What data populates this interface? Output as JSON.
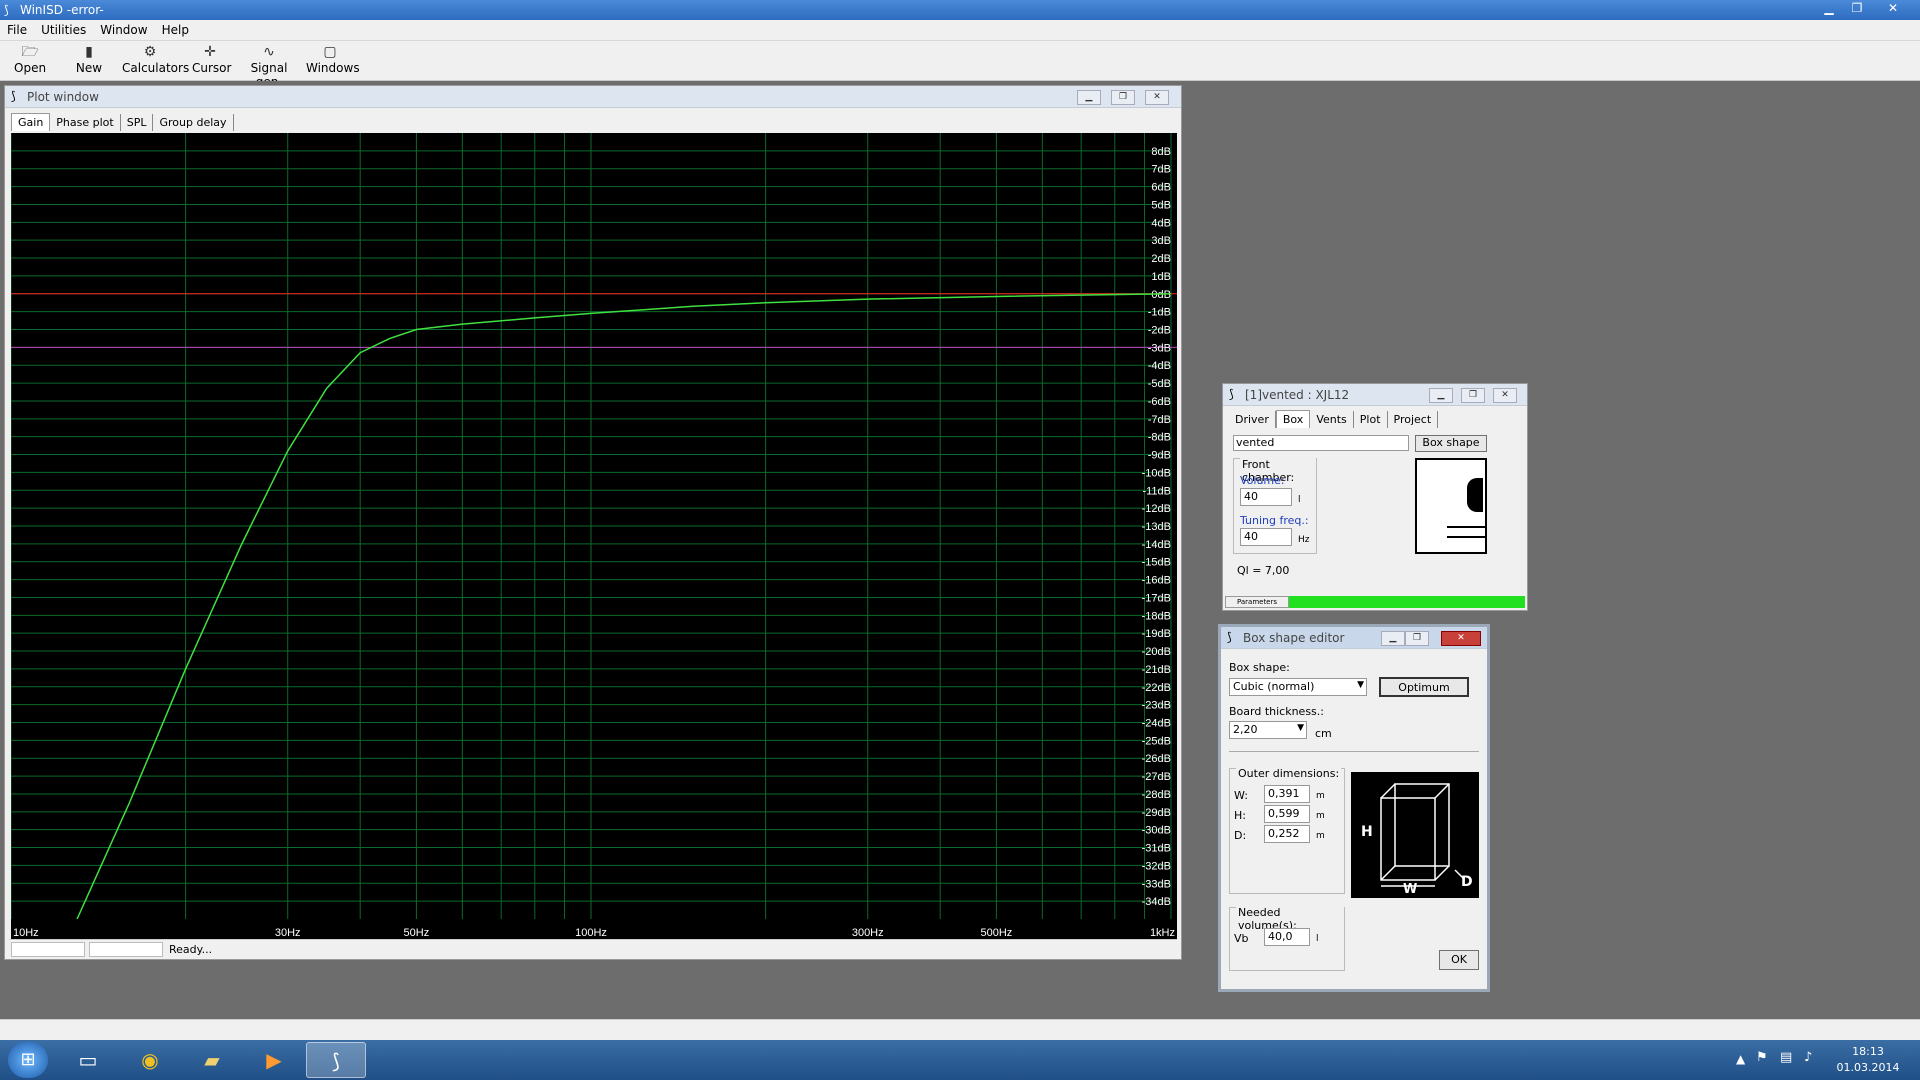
{
  "app": {
    "title": "WinISD -error-"
  },
  "menu": [
    "File",
    "Utilities",
    "Window",
    "Help"
  ],
  "toolbar": [
    {
      "label": "Open",
      "icon": "open-folder-icon",
      "glyph": "🗁"
    },
    {
      "label": "New",
      "icon": "new-file-icon",
      "glyph": "▮"
    },
    {
      "label": "Calculators",
      "icon": "calculators-icon",
      "glyph": "⚙"
    },
    {
      "label": "Cursor",
      "icon": "cursor-icon",
      "glyph": "✛"
    },
    {
      "label": "Signal gen.",
      "icon": "signal-gen-icon",
      "glyph": "∿"
    },
    {
      "label": "Windows",
      "icon": "windows-icon",
      "glyph": "▢"
    }
  ],
  "plot_window": {
    "title": "Plot window",
    "tabs": [
      "Gain",
      "Phase plot",
      "SPL",
      "Group delay"
    ],
    "active_tab": "Gain",
    "status": "Ready..."
  },
  "chart_data": {
    "type": "line",
    "title": "",
    "xlabel": "",
    "ylabel": "",
    "x_scale": "log",
    "xlim": [
      10,
      1000
    ],
    "ylim": [
      -35,
      9
    ],
    "grid": true,
    "x_tick_labels": [
      "10Hz",
      "30Hz",
      "50Hz",
      "100Hz",
      "300Hz",
      "500Hz",
      "1kHz"
    ],
    "x_tick_values": [
      10,
      30,
      50,
      100,
      300,
      500,
      1000
    ],
    "y_tick_values": [
      8,
      7,
      6,
      5,
      4,
      3,
      2,
      1,
      0,
      -1,
      -2,
      -3,
      -4,
      -5,
      -6,
      -7,
      -8,
      -9,
      -10,
      -11,
      -12,
      -13,
      -14,
      -15,
      -16,
      -17,
      -18,
      -19,
      -20,
      -21,
      -22,
      -23,
      -24,
      -25,
      -26,
      -27,
      -28,
      -29,
      -30,
      -31,
      -32,
      -33,
      -34
    ],
    "y_tick_labels": [
      "8dB",
      "7dB",
      "6dB",
      "5dB",
      "4dB",
      "3dB",
      "2dB",
      "1dB",
      "0dB",
      "-1dB",
      "-2dB",
      "-3dB",
      "-4dB",
      "-5dB",
      "-6dB",
      "-7dB",
      "-8dB",
      "-9dB",
      "-10dB",
      "-11dB",
      "-12dB",
      "-13dB",
      "-14dB",
      "-15dB",
      "-16dB",
      "-17dB",
      "-18dB",
      "-19dB",
      "-20dB",
      "-21dB",
      "-22dB",
      "-23dB",
      "-24dB",
      "-25dB",
      "-26dB",
      "-27dB",
      "-28dB",
      "-29dB",
      "-30dB",
      "-31dB",
      "-32dB",
      "-33dB",
      "-34dB"
    ],
    "reference_lines": [
      {
        "y": 0,
        "color": "#ff2020"
      },
      {
        "y": -3,
        "color": "#c040c0"
      }
    ],
    "series": [
      {
        "color": "#40e040",
        "x": [
          13,
          16,
          20,
          25,
          30,
          35,
          40,
          45,
          50,
          60,
          80,
          100,
          150,
          200,
          300,
          500,
          1000
        ],
        "y": [
          -36,
          -28.5,
          -21,
          -14,
          -8.8,
          -5.3,
          -3.3,
          -2.5,
          -2.0,
          -1.7,
          -1.35,
          -1.1,
          -0.7,
          -0.5,
          -0.3,
          -0.15,
          0.0
        ]
      }
    ],
    "colors": {
      "background": "#000000",
      "grid": "#0b6b2a",
      "axis_text": "#ffffff"
    }
  },
  "box_window": {
    "title": "[1]vented : XJL12",
    "tabs": [
      "Driver",
      "Box",
      "Vents",
      "Plot",
      "Project"
    ],
    "active_tab": "Box",
    "box_type": "vented",
    "box_shape_button": "Box shape",
    "front_chamber_label": "Front chamber:",
    "volume_label": "Volume:",
    "volume_value": "40",
    "volume_unit": "l",
    "tuning_label": "Tuning freq.:",
    "tuning_value": "40",
    "tuning_unit": "Hz",
    "ql": "Ql = 7,00",
    "parameters_label": "Parameters"
  },
  "shape_editor": {
    "title": "Box shape editor",
    "box_shape_label": "Box shape:",
    "box_shape_value": "Cubic (normal)",
    "optimum_button": "Optimum",
    "board_thickness_label": "Board thickness.:",
    "board_thickness_value": "2,20",
    "board_thickness_unit": "cm",
    "outer_dimensions_label": "Outer dimensions:",
    "dims": [
      {
        "label": "W:",
        "value": "0,391",
        "unit": "m"
      },
      {
        "label": "H:",
        "value": "0,599",
        "unit": "m"
      },
      {
        "label": "D:",
        "value": "0,252",
        "unit": "m"
      }
    ],
    "diagram_labels": {
      "h": "H",
      "w": "W",
      "d": "D"
    },
    "needed_volume_label": "Needed volume(s):",
    "vb_label": "Vb",
    "vb_value": "40,0",
    "vb_unit": "l",
    "ok_button": "OK"
  },
  "taskbar": {
    "time": "18:13",
    "date": "01.03.2014"
  }
}
